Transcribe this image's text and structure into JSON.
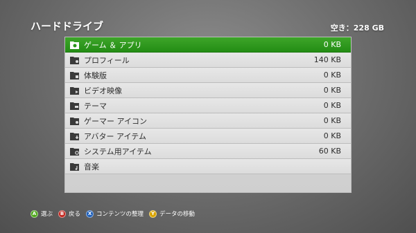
{
  "header": {
    "title": "ハードドライブ",
    "storage": "空き：228 GB"
  },
  "items": [
    {
      "label": "ゲーム ＆ アプリ",
      "size": "0 KB",
      "icon": "games-apps-icon"
    },
    {
      "label": "プロフィール",
      "size": "140 KB",
      "icon": "profile-icon"
    },
    {
      "label": "体験版",
      "size": "0 KB",
      "icon": "demo-icon"
    },
    {
      "label": "ビデオ映像",
      "size": "0 KB",
      "icon": "video-icon"
    },
    {
      "label": "テーマ",
      "size": "0 KB",
      "icon": "theme-icon"
    },
    {
      "label": "ゲーマー アイコン",
      "size": "0 KB",
      "icon": "gamer-icon-icon"
    },
    {
      "label": "アバター アイテム",
      "size": "0 KB",
      "icon": "avatar-item-icon"
    },
    {
      "label": "システム用アイテム",
      "size": "60 KB",
      "icon": "system-item-icon"
    },
    {
      "label": "音楽",
      "size": "",
      "icon": "music-icon"
    }
  ],
  "footer": {
    "hints": [
      {
        "button": "A",
        "label": "選ぶ",
        "color": "#4ea81c"
      },
      {
        "button": "B",
        "label": "戻る",
        "color": "#c1271f"
      },
      {
        "button": "X",
        "label": "コンテンツの整理",
        "color": "#1f5fb8"
      },
      {
        "button": "Y",
        "label": "データの移動",
        "color": "#d9a400"
      }
    ]
  },
  "colors": {
    "selected": "#2a961a",
    "row": "#e2e2e2"
  }
}
